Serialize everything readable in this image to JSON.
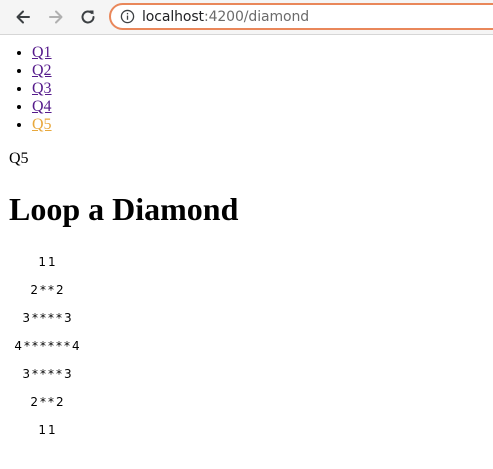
{
  "browser": {
    "url_host": "localhost",
    "url_path": ":4200/diamond"
  },
  "nav": {
    "items": [
      {
        "label": "Q1"
      },
      {
        "label": "Q2"
      },
      {
        "label": "Q3"
      },
      {
        "label": "Q4"
      },
      {
        "label": "Q5"
      }
    ],
    "active_color": "#e8a83c",
    "link_color": "#551a8b"
  },
  "page": {
    "current": "Q5",
    "title": "Loop a Diamond"
  },
  "diamond": {
    "rows": [
      "11",
      "2**2",
      "3****3",
      "4******4",
      "3****3",
      "2**2",
      "11"
    ]
  }
}
